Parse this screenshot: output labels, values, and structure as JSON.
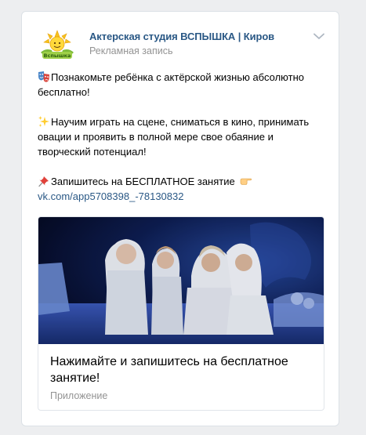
{
  "post": {
    "author": "Актерская студия ВСПЫШКА | Киров",
    "subtitle": "Рекламная запись",
    "avatar_icon": "sun-logo-icon",
    "avatar_text": "Вспышка",
    "paragraphs": [
      {
        "emoji": "theater-masks-icon",
        "text": "Познакомьте ребёнка с актёрской жизнью абсолютно бесплатно!"
      },
      {
        "emoji": "sparkles-icon",
        "text": "Научим играть на сцене, сниматься в кино, принимать овации и проявить в полной мере свое обаяние и творческий потенциал!"
      },
      {
        "emoji": "pushpin-icon",
        "text": "Запишитесь на БЕСПЛАТНОЕ занятие",
        "trailing_emoji": "pointing-hand-icon",
        "link": "vk.com/app5708398_-78130832"
      }
    ],
    "card": {
      "title": "Нажимайте и запишитесь на бесплатное занятие!",
      "caption": "Приложение",
      "image": "children-on-stage-photo"
    }
  },
  "colors": {
    "link": "#2a5885",
    "muted": "#939393",
    "background": "#edeef0",
    "border": "#dce1e6"
  }
}
